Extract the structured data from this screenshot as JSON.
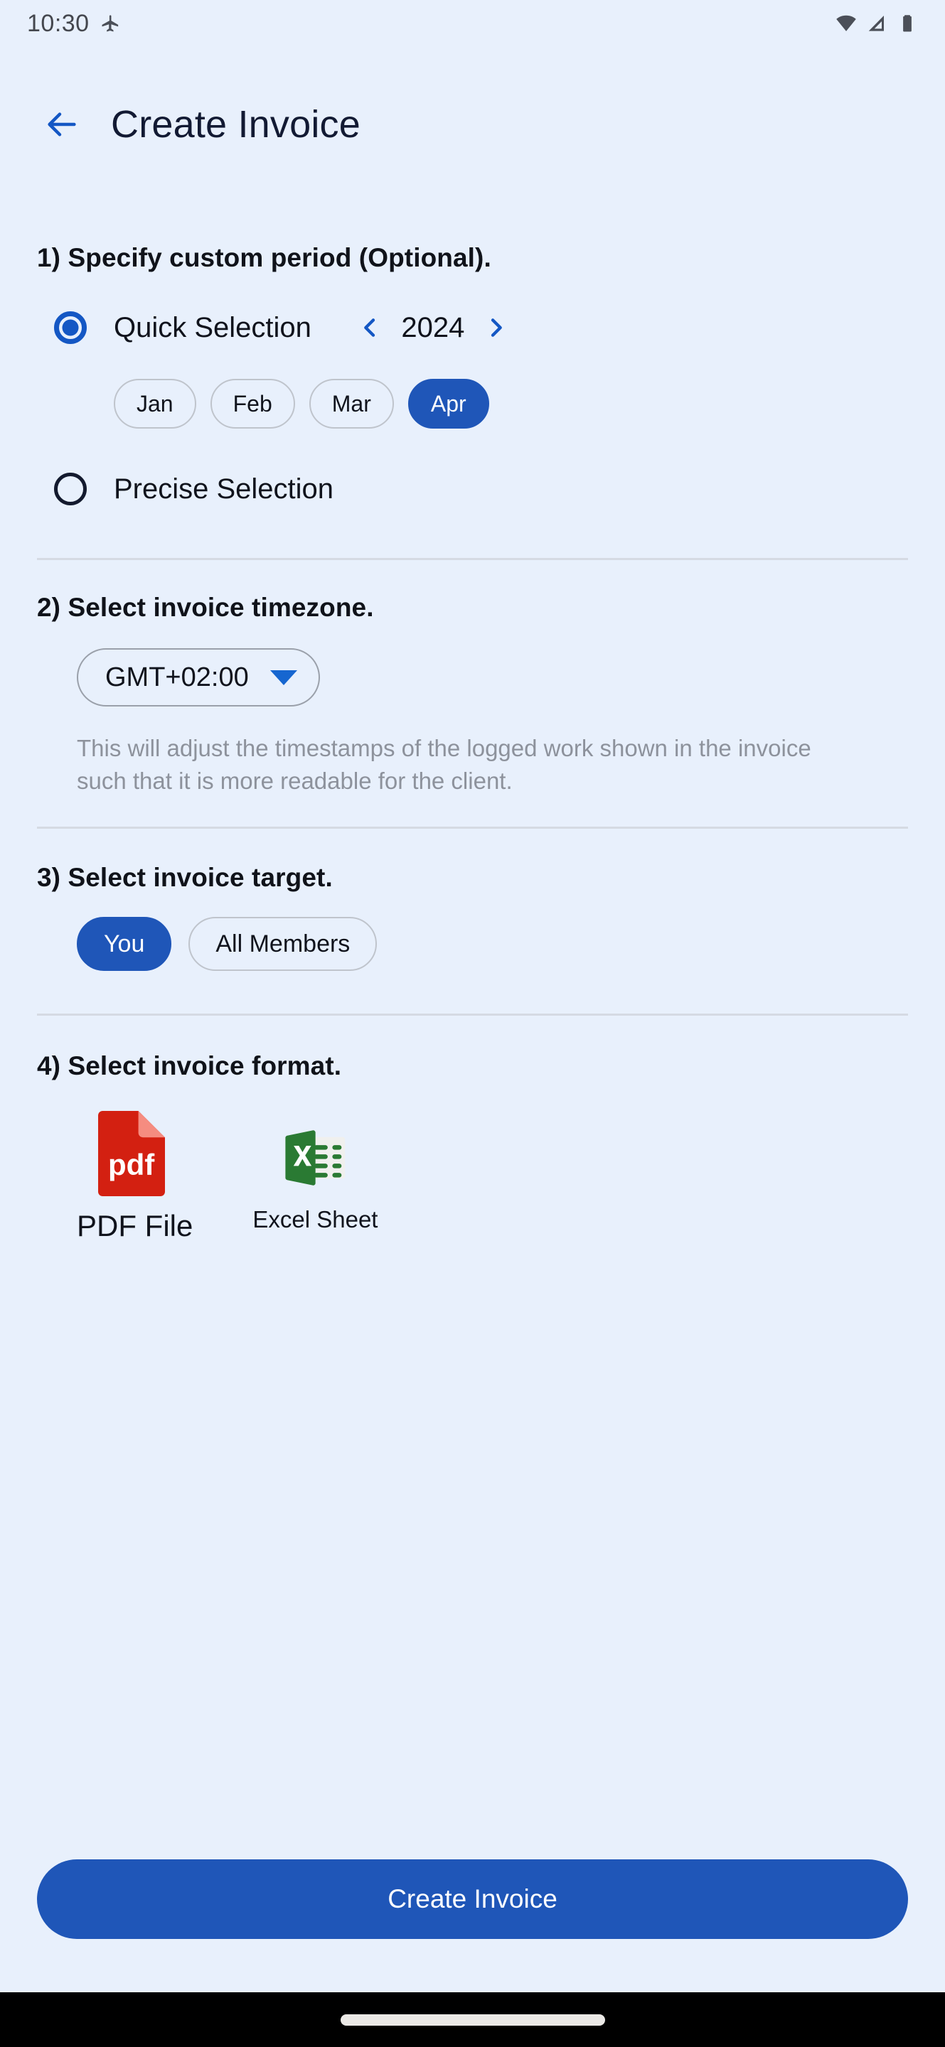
{
  "status_bar": {
    "time": "10:30",
    "icons": [
      "flight-mode-icon",
      "wifi-icon",
      "signal-icon",
      "battery-icon"
    ]
  },
  "app_bar": {
    "back_icon": "arrow-back-icon",
    "title": "Create Invoice"
  },
  "colors": {
    "background": "#e8f0fc",
    "accent": "#1f56b8",
    "accent_light": "#1666d0",
    "text": "#10131c",
    "muted_text": "#8d929c",
    "divider": "#d5dae3",
    "pdf_red": "#d32011",
    "excel_green": "#2a7a33"
  },
  "section1": {
    "title": "1) Specify custom period (Optional).",
    "quick": {
      "label": "Quick Selection",
      "selected": true,
      "prev_icon": "chevron-left-icon",
      "next_icon": "chevron-right-icon",
      "year": "2024",
      "months": [
        {
          "label": "Jan",
          "selected": false
        },
        {
          "label": "Feb",
          "selected": false
        },
        {
          "label": "Mar",
          "selected": false
        },
        {
          "label": "Apr",
          "selected": true
        }
      ]
    },
    "precise": {
      "label": "Precise Selection",
      "selected": false
    }
  },
  "section2": {
    "title": "2) Select invoice timezone.",
    "timezone_value": "GMT+02:00",
    "caret_icon": "chevron-down-icon",
    "helper_text": "This will adjust the timestamps of the logged work shown in the invoice such that it is more readable for the client."
  },
  "section3": {
    "title": "3) Select invoice target.",
    "options": [
      {
        "label": "You",
        "selected": true
      },
      {
        "label": "All Members",
        "selected": false
      }
    ]
  },
  "section4": {
    "title": "4) Select invoice format.",
    "options": [
      {
        "label": "PDF File",
        "icon": "pdf-file-icon",
        "badge": "pdf",
        "selected": true
      },
      {
        "label": "Excel Sheet",
        "icon": "excel-file-icon",
        "badge": "x",
        "selected": false
      }
    ]
  },
  "footer": {
    "cta_label": "Create Invoice"
  }
}
